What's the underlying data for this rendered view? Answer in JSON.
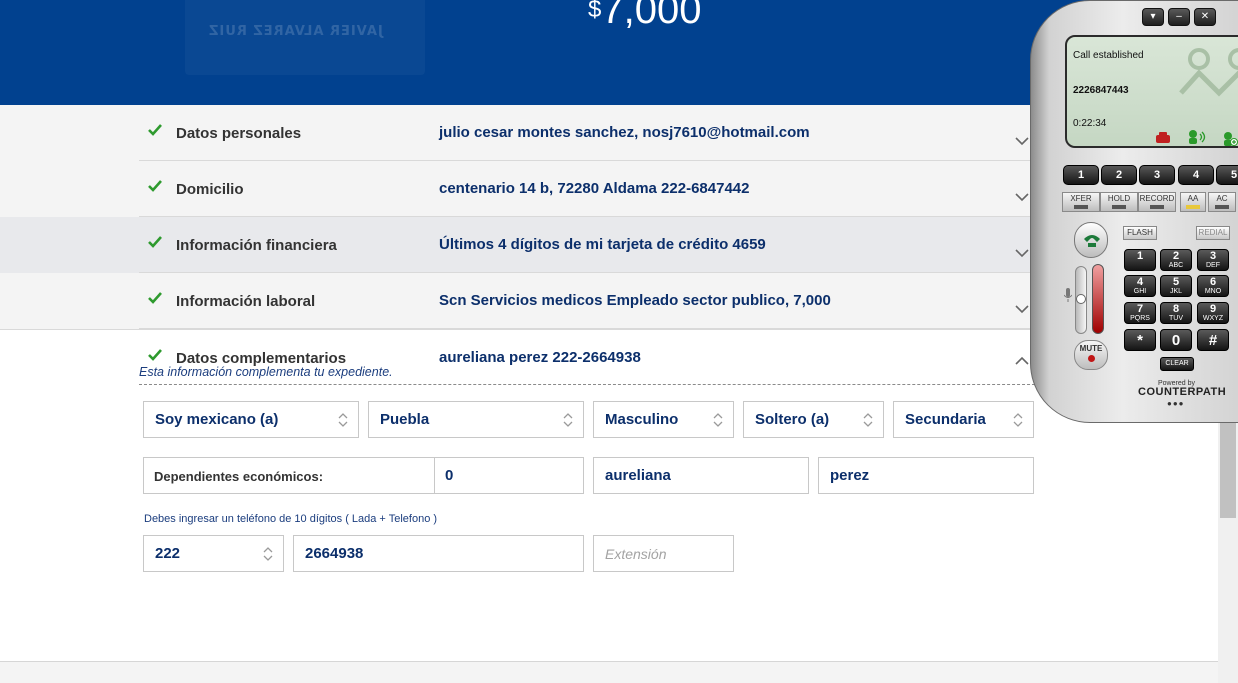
{
  "header": {
    "watermark_text": "JAVIER ALVAREZ RUIZ",
    "currency": "$",
    "amount": "7,000"
  },
  "sections": [
    {
      "label": "Datos personales",
      "value": "julio cesar montes sanchez, nosj7610@hotmail.com",
      "state": "collapsed"
    },
    {
      "label": "Domicilio",
      "value": "centenario 14 b, 72280 Aldama 222-6847442",
      "state": "collapsed"
    },
    {
      "label": "Información financiera",
      "value": "Últimos 4 dígitos de mi tarjeta de crédito 4659",
      "state": "collapsed"
    },
    {
      "label": "Información laboral",
      "value": "Scn Servicios medicos Empleado sector publico, 7,000",
      "state": "collapsed"
    },
    {
      "label": "Datos complementarios",
      "value": "aureliana perez 222-2664938",
      "state": "expanded"
    }
  ],
  "complementary": {
    "note": "Esta información complementa tu expediente.",
    "selects": {
      "nationality": "Soy mexicano (a)",
      "state": "Puebla",
      "gender": "Masculino",
      "marital_status": "Soltero (a)",
      "education": "Secundaria"
    },
    "dependents_label": "Dependientes económicos:",
    "dependents_value": "0",
    "reference_first_name": "aureliana",
    "reference_last_name": "perez",
    "phone_hint": "Debes ingresar un teléfono de 10 dígitos ( Lada + Telefono )",
    "lada": "222",
    "phone": "2664938",
    "extension_placeholder": "Extensión"
  },
  "softphone": {
    "status": "Call established",
    "number": "2226847443",
    "timer": "0:22:34",
    "line_buttons": [
      "1",
      "2",
      "3",
      "4",
      "5"
    ],
    "function_buttons": [
      "XFER",
      "HOLD",
      "RECORD",
      "AA",
      "AC"
    ],
    "flash_label": "FLASH",
    "redial_label": "REDIAL",
    "mute_label": "MUTE",
    "clear_label": "CLEAR",
    "keypad": [
      {
        "main": "1",
        "sub": ""
      },
      {
        "main": "2",
        "sub": "ABC"
      },
      {
        "main": "3",
        "sub": "DEF"
      },
      {
        "main": "4",
        "sub": "GHI"
      },
      {
        "main": "5",
        "sub": "JKL"
      },
      {
        "main": "6",
        "sub": "MNO"
      },
      {
        "main": "7",
        "sub": "PQRS"
      },
      {
        "main": "8",
        "sub": "TUV"
      },
      {
        "main": "9",
        "sub": "WXYZ"
      },
      {
        "main": "*",
        "sub": ""
      },
      {
        "main": "0",
        "sub": ""
      },
      {
        "main": "#",
        "sub": ""
      }
    ],
    "powered_by": "Powered by",
    "brand": "COUNTERPATH"
  },
  "colors": {
    "header_bg": "#01418f",
    "check_green": "#2e9a2e",
    "value_navy": "#0c2f6b"
  }
}
